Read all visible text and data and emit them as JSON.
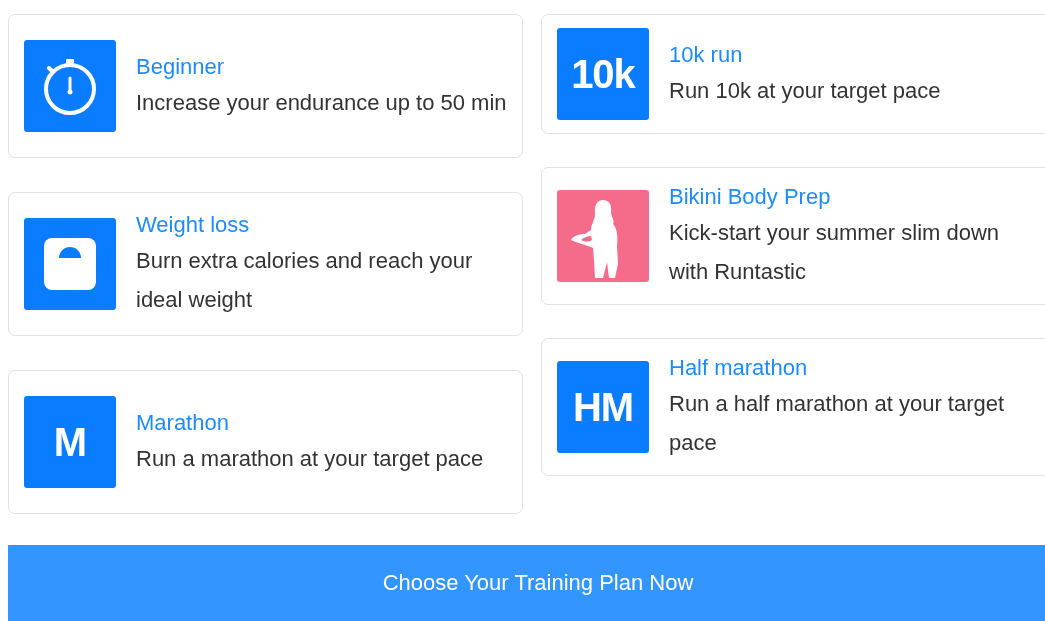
{
  "columns": [
    {
      "cards": [
        {
          "title": "Beginner",
          "description": "Increase your endurance up to 50 min",
          "icon": {
            "kind": "stopwatch"
          },
          "color": "#0a7cff"
        },
        {
          "title": "Weight loss",
          "description": "Burn extra calories and reach your ideal weight",
          "icon": {
            "kind": "scale"
          },
          "color": "#0a7cff"
        },
        {
          "title": "Marathon",
          "description": "Run a marathon at your target pace",
          "icon": {
            "kind": "text",
            "text": "M"
          },
          "color": "#0a7cff"
        }
      ]
    },
    {
      "cards": [
        {
          "title": "10k run",
          "description": "Run 10k at your target pace",
          "icon": {
            "kind": "text",
            "text": "10k"
          },
          "color": "#0a7cff"
        },
        {
          "title": "Bikini Body Prep",
          "description": "Kick-start your summer slim down with Runtastic",
          "icon": {
            "kind": "figure"
          },
          "color": "#f56b8a"
        },
        {
          "title": "Half marathon",
          "description": "Run a half marathon at your target pace",
          "icon": {
            "kind": "text",
            "text": "HM"
          },
          "color": "#0a7cff"
        }
      ]
    }
  ],
  "button": {
    "label": "Choose Your Training Plan Now"
  }
}
